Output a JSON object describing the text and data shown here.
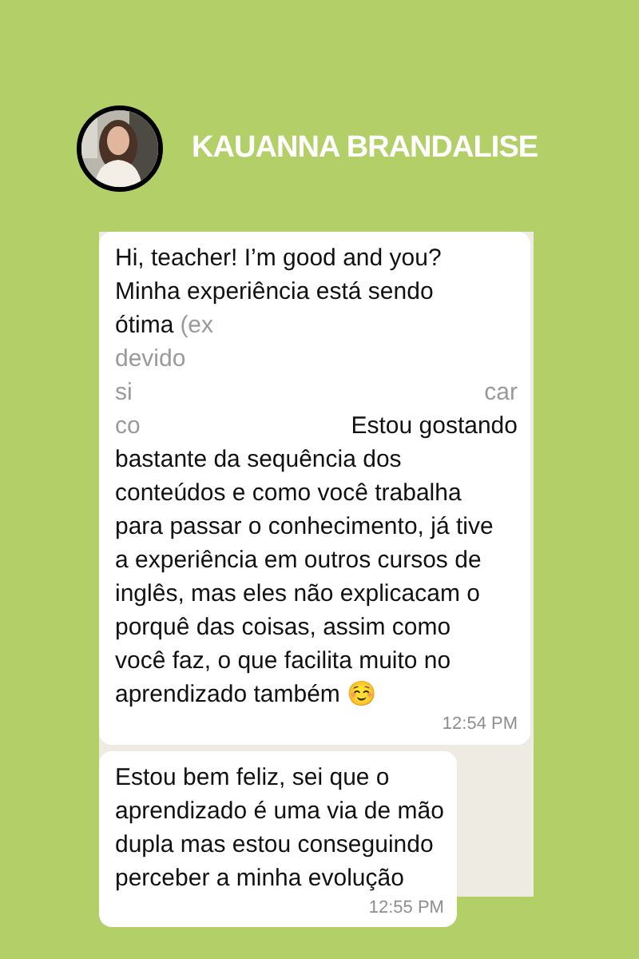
{
  "author": {
    "name": "KAUANNA BRANDALISE"
  },
  "messages": [
    {
      "lines": [
        {
          "spread": false,
          "segments": [
            {
              "text": "Hi, teacher! I’m good and you?",
              "faded": false
            }
          ]
        },
        {
          "spread": false,
          "segments": [
            {
              "text": "Minha experiência está sendo",
              "faded": false
            }
          ]
        },
        {
          "spread": false,
          "segments": [
            {
              "text": "ótima",
              "faded": false
            },
            {
              "text": "(ex",
              "faded": true
            }
          ]
        },
        {
          "spread": false,
          "segments": [
            {
              "text": "devido",
              "faded": true
            }
          ]
        },
        {
          "spread": true,
          "segments": [
            {
              "text": "si",
              "faded": true
            },
            {
              "text": "car",
              "faded": true
            }
          ]
        },
        {
          "spread": true,
          "segments": [
            {
              "text": "co",
              "faded": true
            },
            {
              "text": "Estou gostando",
              "faded": false
            }
          ]
        },
        {
          "spread": false,
          "segments": [
            {
              "text": "bastante da sequência dos",
              "faded": false
            }
          ]
        },
        {
          "spread": false,
          "segments": [
            {
              "text": "conteúdos e como você trabalha",
              "faded": false
            }
          ]
        },
        {
          "spread": false,
          "segments": [
            {
              "text": "para passar o conhecimento, já tive",
              "faded": false
            }
          ]
        },
        {
          "spread": false,
          "segments": [
            {
              "text": "a experiência em outros cursos de",
              "faded": false
            }
          ]
        },
        {
          "spread": false,
          "segments": [
            {
              "text": "inglês, mas eles não explicacam o",
              "faded": false
            }
          ]
        },
        {
          "spread": false,
          "segments": [
            {
              "text": "porquê das coisas, assim como",
              "faded": false
            }
          ]
        },
        {
          "spread": false,
          "segments": [
            {
              "text": "você faz, o que facilita muito no",
              "faded": false
            }
          ]
        },
        {
          "spread": false,
          "segments": [
            {
              "text": "aprendizado também ☺️",
              "faded": false
            }
          ]
        }
      ],
      "time": "12:54 PM"
    },
    {
      "lines": [
        {
          "spread": false,
          "segments": [
            {
              "text": "Estou bem feliz, sei que o",
              "faded": false
            }
          ]
        },
        {
          "spread": false,
          "segments": [
            {
              "text": "aprendizado é uma via de mão",
              "faded": false
            }
          ]
        },
        {
          "spread": false,
          "segments": [
            {
              "text": "dupla mas estou conseguindo",
              "faded": false
            }
          ]
        },
        {
          "spread": false,
          "segments": [
            {
              "text": "perceber a minha evolução",
              "faded": false
            }
          ]
        }
      ],
      "time": "12:55 PM"
    }
  ]
}
